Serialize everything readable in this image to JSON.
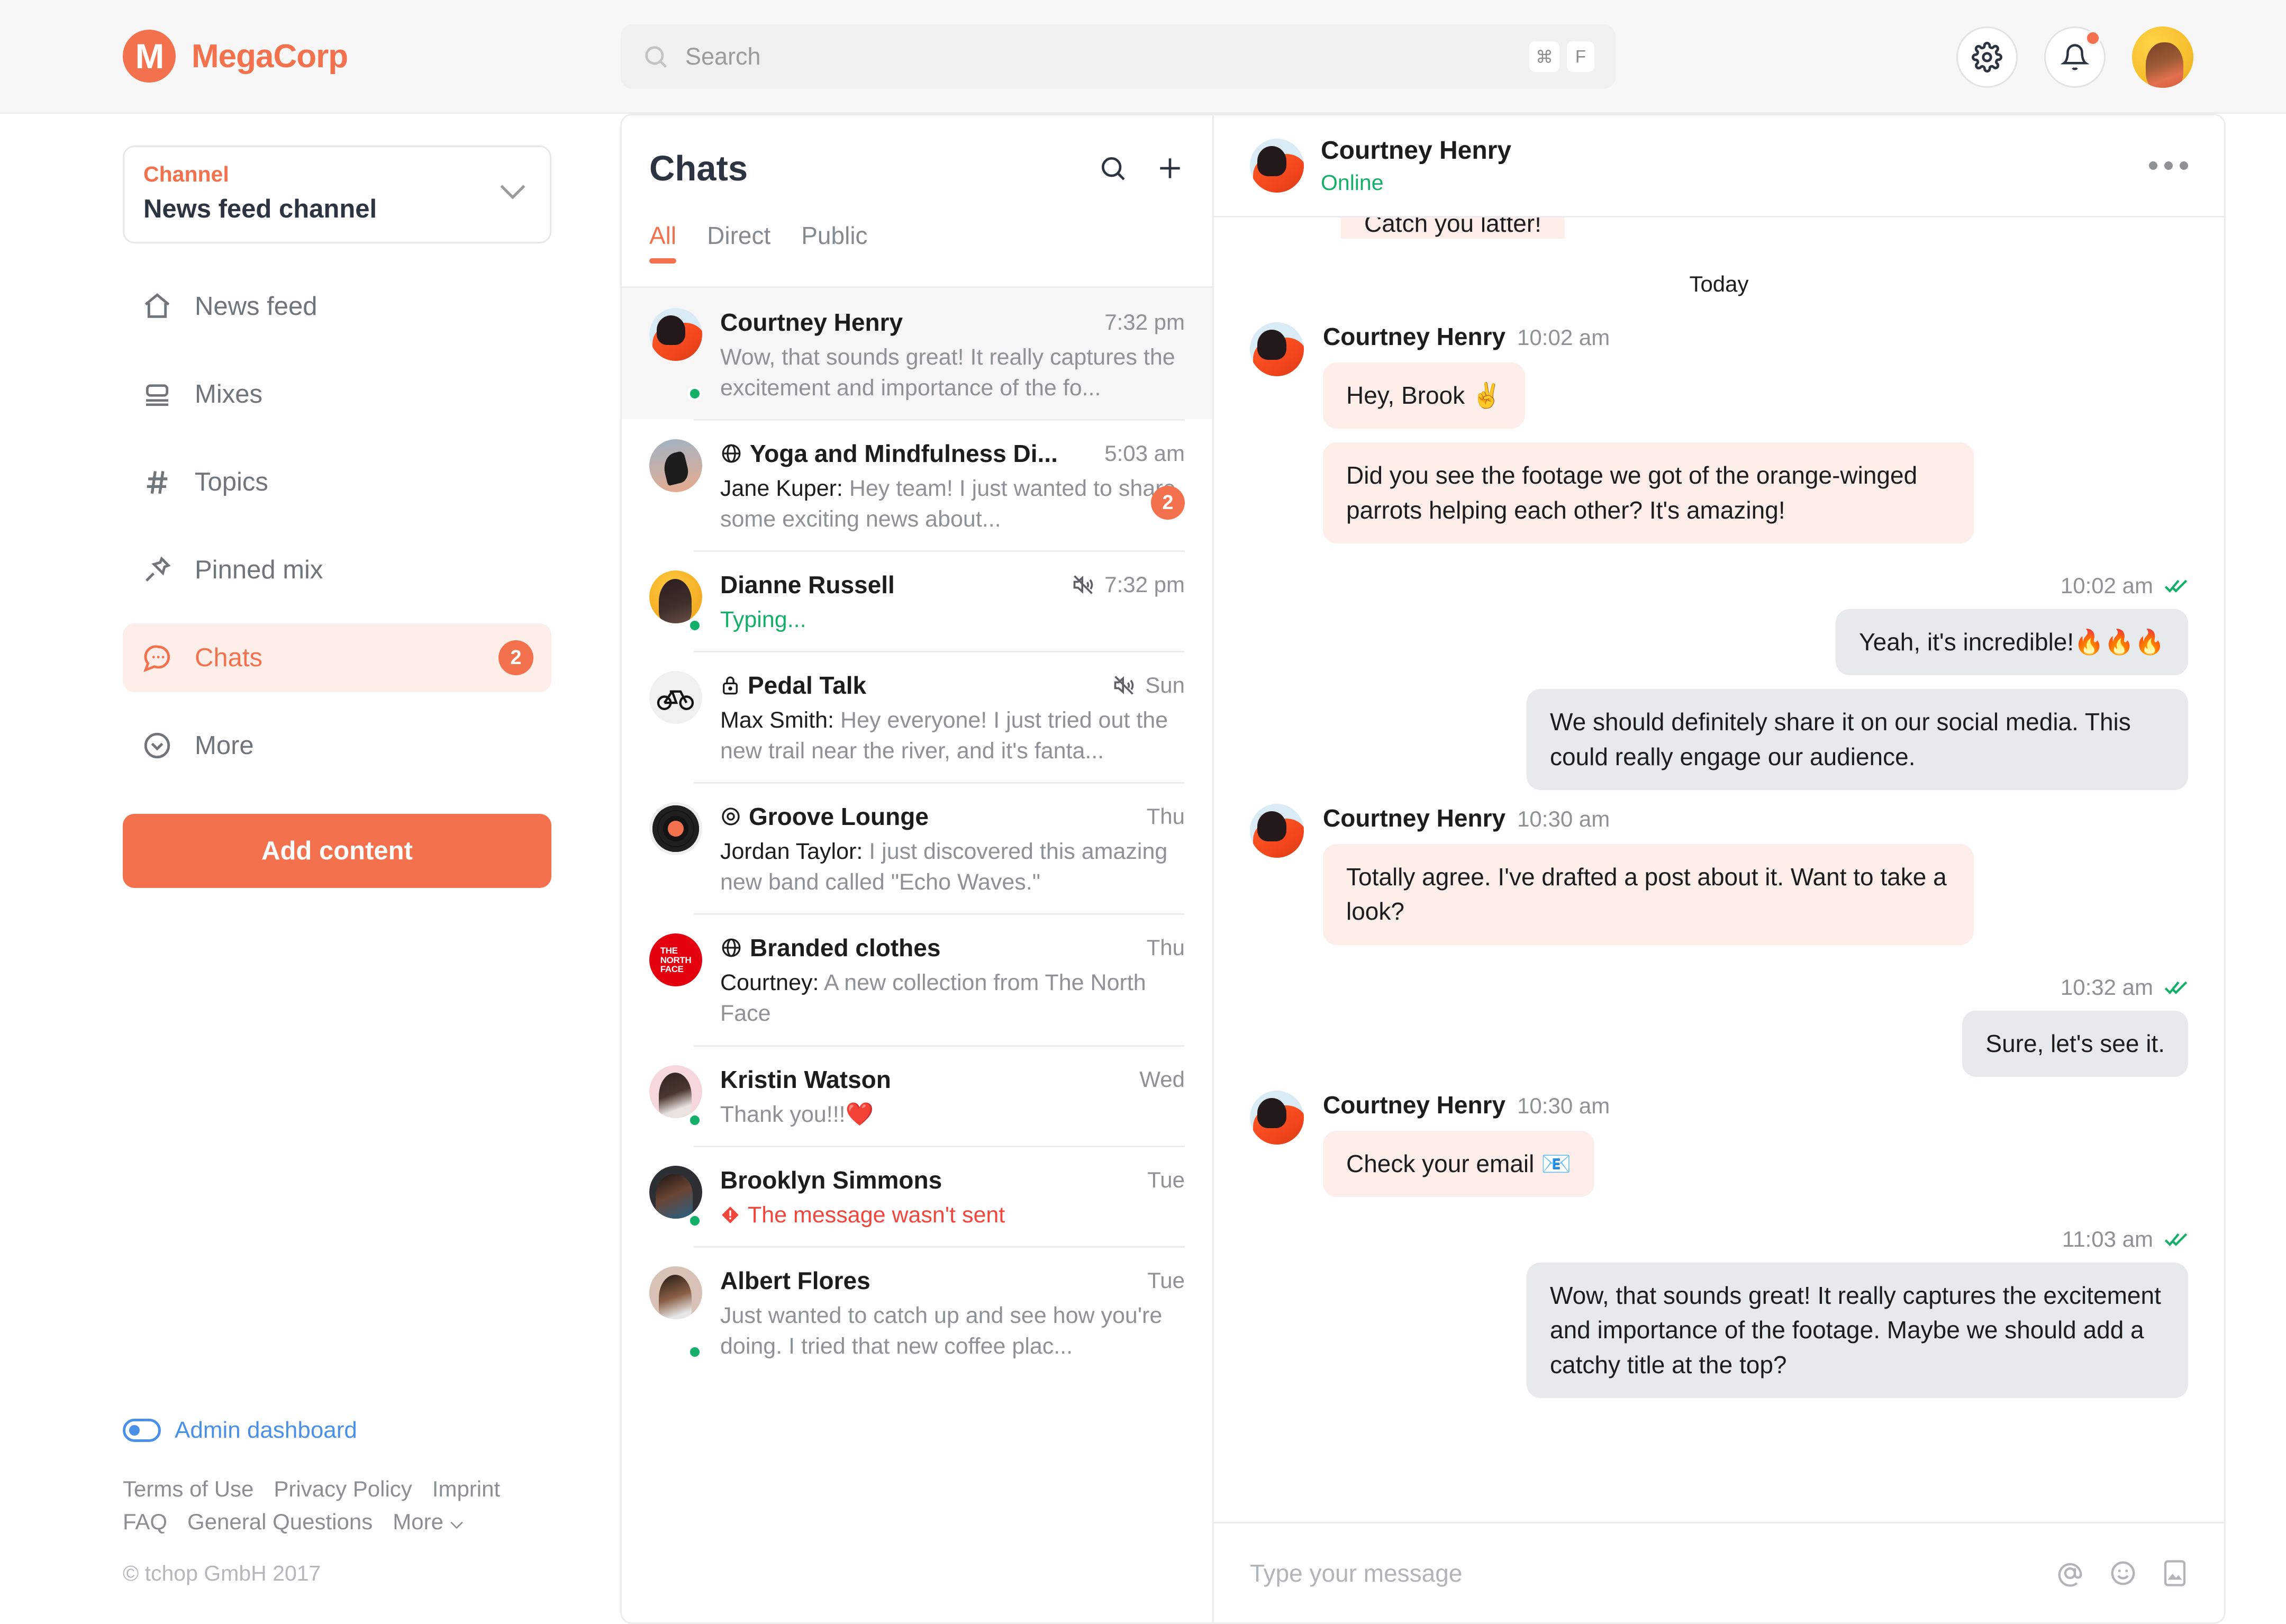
{
  "brand": {
    "initial": "M",
    "name": "MegaCorp"
  },
  "search": {
    "placeholder": "Search",
    "kbd1": "⌘",
    "kbd2": "F"
  },
  "sidebar": {
    "channel_label": "Channel",
    "channel_value": "News feed channel",
    "items": [
      {
        "label": "News feed",
        "icon": "home-icon",
        "badge": ""
      },
      {
        "label": "Mixes",
        "icon": "layers-icon",
        "badge": ""
      },
      {
        "label": "Topics",
        "icon": "hash-icon",
        "badge": ""
      },
      {
        "label": "Pinned mix",
        "icon": "pin-icon",
        "badge": ""
      },
      {
        "label": "Chats",
        "icon": "chat-bubble-icon",
        "badge": "2"
      },
      {
        "label": "More",
        "icon": "chevron-circle-down-icon",
        "badge": ""
      }
    ],
    "add_content": "Add content",
    "admin_dashboard": "Admin dashboard",
    "footer_links": [
      "Terms of Use",
      "Privacy Policy",
      "Imprint",
      "FAQ",
      "General Questions",
      "More"
    ],
    "copyright": "© tchop GmbH 2017"
  },
  "chatlist": {
    "title": "Chats",
    "tabs": [
      "All",
      "Direct",
      "Public"
    ],
    "active_tab": "All",
    "items": [
      {
        "name": "Courtney Henry",
        "prefix_icon": "",
        "time": "7:32 pm",
        "sender": "",
        "preview": "Wow, that sounds great! It really captures the excitement and importance of the fo...",
        "muted": false,
        "online": true,
        "unread": "",
        "selected": true,
        "avatar": "ava-courtney",
        "state": ""
      },
      {
        "name": "Yoga and Mindfulness Di...",
        "prefix_icon": "globe-icon",
        "time": "5:03 am",
        "sender": "Jane Kuper:",
        "preview": "Hey team! I just wanted to share some exciting news about...",
        "muted": false,
        "online": false,
        "unread": "2",
        "selected": false,
        "avatar": "ava-yoga",
        "state": ""
      },
      {
        "name": "Dianne Russell",
        "prefix_icon": "",
        "time": "7:32 pm",
        "sender": "",
        "preview": "Typing...",
        "muted": true,
        "online": true,
        "unread": "",
        "selected": false,
        "avatar": "ava-dianne",
        "state": "typing"
      },
      {
        "name": "Pedal Talk",
        "prefix_icon": "lock-icon",
        "time": "Sun",
        "sender": "Max Smith:",
        "preview": "Hey everyone! I just tried out the new trail near the river, and it's fanta...",
        "muted": true,
        "online": false,
        "unread": "",
        "selected": false,
        "avatar": "ava-bike",
        "state": ""
      },
      {
        "name": "Groove Lounge",
        "prefix_icon": "eye-icon",
        "time": "Thu",
        "sender": "Jordan Taylor:",
        "preview": "I just discovered this amazing new band called \"Echo Waves.\"",
        "muted": false,
        "online": false,
        "unread": "",
        "selected": false,
        "avatar": "ava-vinyl",
        "state": ""
      },
      {
        "name": "Branded clothes",
        "prefix_icon": "globe-icon",
        "time": "Thu",
        "sender": "Courtney:",
        "preview": "A new collection from The North Face",
        "muted": false,
        "online": false,
        "unread": "",
        "selected": false,
        "avatar": "ava-tnf",
        "state": ""
      },
      {
        "name": "Kristin Watson",
        "prefix_icon": "",
        "time": "Wed",
        "sender": "",
        "preview": "Thank you!!!❤️",
        "muted": false,
        "online": true,
        "unread": "",
        "selected": false,
        "avatar": "ava-kristin",
        "state": ""
      },
      {
        "name": "Brooklyn Simmons",
        "prefix_icon": "",
        "time": "Tue",
        "sender": "",
        "preview": "The message wasn't sent",
        "muted": false,
        "online": true,
        "unread": "",
        "selected": false,
        "avatar": "ava-brooklyn",
        "state": "error"
      },
      {
        "name": "Albert Flores",
        "prefix_icon": "",
        "time": "Tue",
        "sender": "",
        "preview": "Just wanted to catch up and see how you're doing. I tried that new coffee plac...",
        "muted": false,
        "online": true,
        "unread": "",
        "selected": false,
        "avatar": "ava-albert",
        "state": ""
      }
    ]
  },
  "conversation": {
    "name": "Courtney Henry",
    "status": "Online",
    "clipped_message": "Catch you latter!",
    "day_divider": "Today",
    "groups": [
      {
        "type": "incoming",
        "sender": "Courtney Henry",
        "time": "10:02 am",
        "bubbles": [
          "Hey, Brook ✌️",
          "Did you see the footage we got of the orange-winged parrots helping each other? It's amazing!"
        ]
      },
      {
        "type": "outgoing",
        "receipt_time": "10:02 am",
        "bubbles": [
          "Yeah, it's incredible!🔥🔥🔥",
          "We should definitely share it on our social media. This could really engage our audience."
        ]
      },
      {
        "type": "incoming",
        "sender": "Courtney Henry",
        "time": "10:30 am",
        "bubbles": [
          "Totally agree. I've drafted a post about it. Want to take a look?"
        ]
      },
      {
        "type": "outgoing",
        "receipt_time": "10:32 am",
        "bubbles": [
          "Sure, let's see it."
        ]
      },
      {
        "type": "incoming",
        "sender": "Courtney Henry",
        "time": "10:30 am",
        "bubbles": [
          "Check your email 📧"
        ]
      },
      {
        "type": "outgoing",
        "receipt_time": "11:03 am",
        "bubbles": [
          "Wow, that sounds great! It really captures the excitement and importance of the footage. Maybe we should add a catchy title at the top?"
        ]
      }
    ],
    "composer_placeholder": "Type your message"
  },
  "colors": {
    "accent": "#f4714e",
    "incoming_bubble": "#fdeeea",
    "outgoing_bubble": "#e6eaec",
    "online": "#14b06a",
    "error": "#f0463c",
    "link": "#4a90e8"
  }
}
